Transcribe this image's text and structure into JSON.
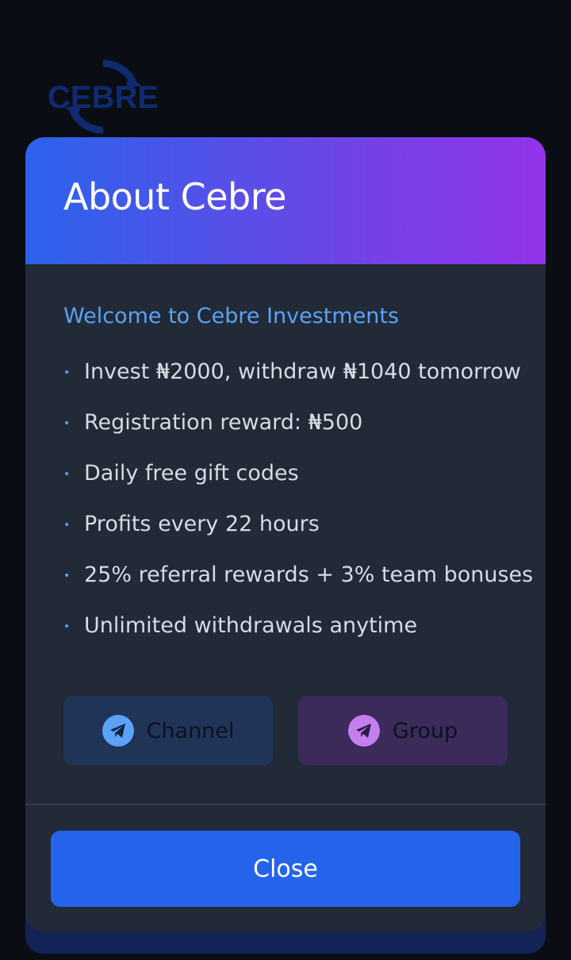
{
  "background": {
    "logo_text": "CEBRE",
    "logo_color": "#0f2a6e"
  },
  "modal": {
    "title": "About Cebre",
    "welcome": "Welcome to Cebre Investments",
    "features": [
      "Invest ₦2000, withdraw ₦1040 tomorrow",
      "Registration reward: ₦500",
      "Daily free gift codes",
      "Profits every 22 hours",
      "25% referral rewards + 3% team bonuses",
      "Unlimited withdrawals anytime"
    ],
    "bullet": "•",
    "buttons": {
      "channel_label": "Channel",
      "group_label": "Group",
      "channel_icon": "telegram-icon",
      "group_icon": "telegram-icon"
    },
    "close_label": "Close"
  },
  "colors": {
    "header_gradient_start": "#2b63ec",
    "header_gradient_end": "#9333ea",
    "accent_blue": "#5aa2f5",
    "accent_purple": "#c47ef0",
    "close_button": "#2563eb",
    "modal_bg": "#222a37",
    "page_bg": "#0a0d14"
  }
}
